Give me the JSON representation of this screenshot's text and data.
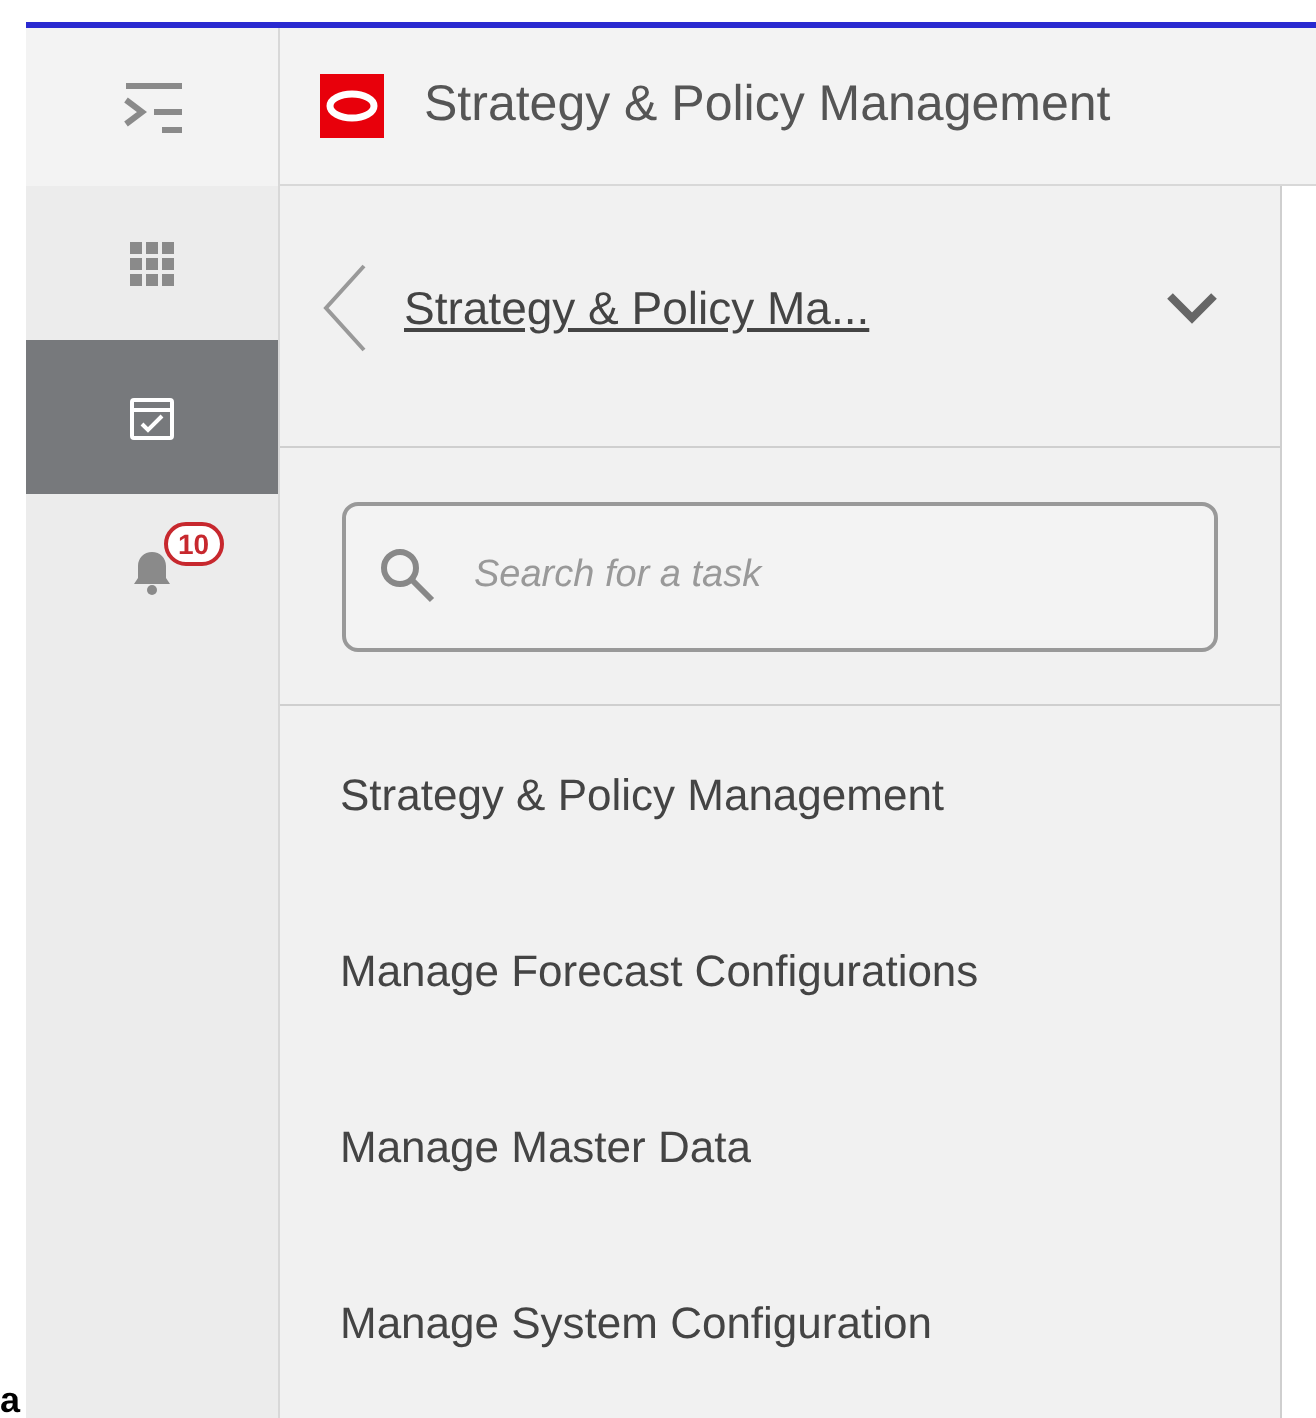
{
  "header": {
    "title": "Strategy & Policy Management"
  },
  "rail": {
    "items": [
      {
        "kind": "grid",
        "selected": false
      },
      {
        "kind": "tasks",
        "selected": true
      },
      {
        "kind": "notifications",
        "selected": false,
        "badge": "10"
      }
    ]
  },
  "panel": {
    "title": "Strategy & Policy Ma...",
    "search": {
      "placeholder": "Search for a task"
    },
    "tasks": [
      "Strategy & Policy Management",
      "Manage Forecast Configurations",
      "Manage Master Data",
      "Manage System Configuration"
    ]
  },
  "corner_text": "a"
}
